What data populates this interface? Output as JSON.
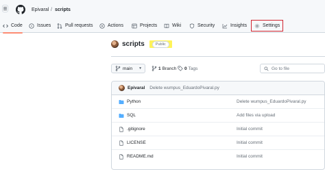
{
  "header": {
    "owner": "Epivaral",
    "separator": "/",
    "repo": "scripts"
  },
  "tabs": [
    {
      "label": "Code",
      "icon": "code-icon",
      "active": true
    },
    {
      "label": "Issues",
      "icon": "issue-icon"
    },
    {
      "label": "Pull requests",
      "icon": "pull-request-icon"
    },
    {
      "label": "Actions",
      "icon": "play-icon"
    },
    {
      "label": "Projects",
      "icon": "table-icon"
    },
    {
      "label": "Wiki",
      "icon": "book-icon"
    },
    {
      "label": "Security",
      "icon": "shield-icon"
    },
    {
      "label": "Insights",
      "icon": "graph-icon"
    },
    {
      "label": "Settings",
      "icon": "gear-icon",
      "highlighted": true
    }
  ],
  "repo": {
    "name": "scripts",
    "visibility": "Public"
  },
  "toolbar": {
    "branch": "main",
    "branch_count": "1",
    "branch_label": "Branch",
    "tag_count": "0",
    "tag_label": "Tags",
    "search_placeholder": "Go to file"
  },
  "latest_commit": {
    "author": "Epivaral",
    "message": "Delete wumpus_EduardoPivaral.py"
  },
  "files": [
    {
      "name": "Python",
      "type": "folder",
      "commit": "Delete wumpus_EduardoPivaral.py"
    },
    {
      "name": "SQL",
      "type": "folder",
      "commit": "Add files via upload"
    },
    {
      "name": ".gitignore",
      "type": "file",
      "commit": "Initial commit"
    },
    {
      "name": "LICENSE",
      "type": "file",
      "commit": "Initial commit"
    },
    {
      "name": "README.md",
      "type": "file",
      "commit": "Initial commit"
    }
  ],
  "colors": {
    "accent_underline": "#fd8c73",
    "highlight_box": "#d1242f",
    "highlight_marker": "#fff35a",
    "folder": "#54aeff"
  }
}
